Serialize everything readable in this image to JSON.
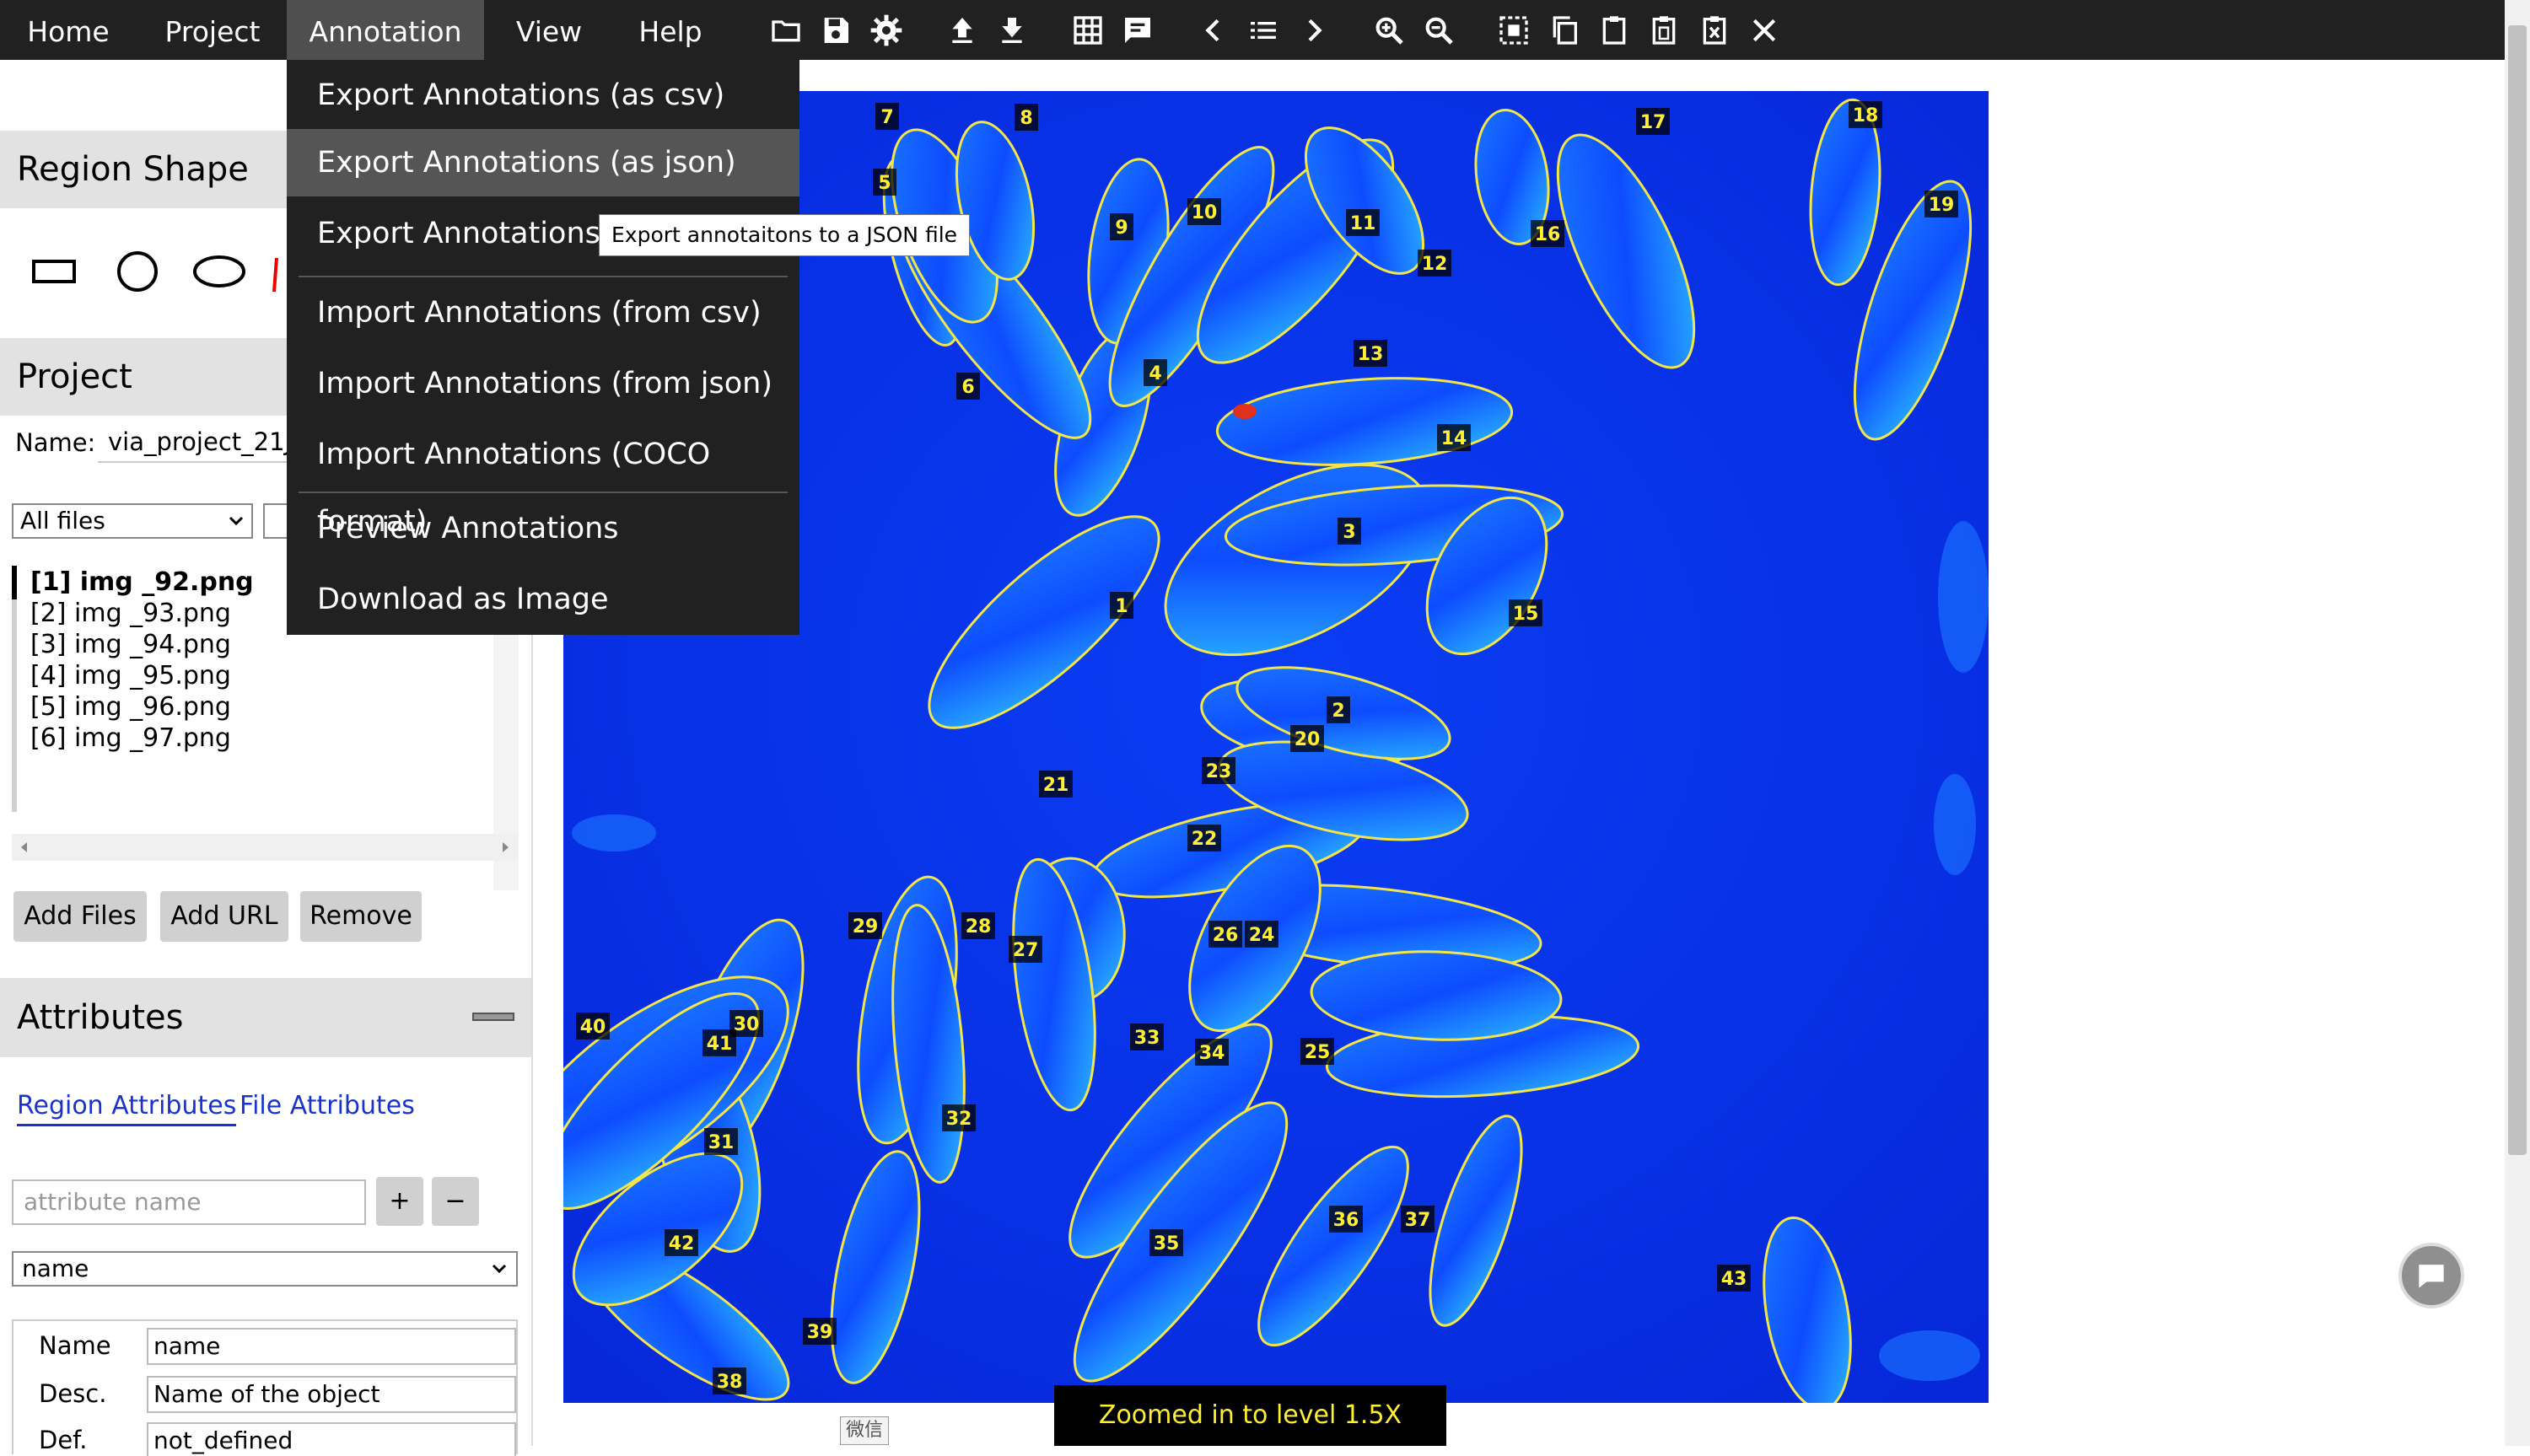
{
  "menubar": {
    "items": [
      "Home",
      "Project",
      "Annotation",
      "View",
      "Help"
    ],
    "active": "Annotation"
  },
  "toolbar_icons": [
    "folder-open-icon",
    "save-icon",
    "settings-icon",
    "upload-icon",
    "download-icon",
    "grid-view-icon",
    "comment-icon",
    "previous-icon",
    "list-icon",
    "next-icon",
    "zoom-in-icon",
    "zoom-out-icon",
    "select-all-icon",
    "copy-icon",
    "paste-icon",
    "paste-special-icon",
    "delete-region-icon",
    "close-icon"
  ],
  "annotation_menu": {
    "items": [
      "Export Annotations (as csv)",
      "Export Annotations (as json)",
      "Export Annotations (COCO format)",
      "Import Annotations (from csv)",
      "Import Annotations (from json)",
      "Import Annotations (COCO format)",
      "Preview Annotations",
      "Download as Image"
    ],
    "visible_item_3": "Export Annotations (C",
    "highlighted": "Export Annotations (as json)",
    "tooltip": "Export annotaitons to a JSON file"
  },
  "region_shape": {
    "title": "Region Shape"
  },
  "project": {
    "title": "Project",
    "name_label": "Name:",
    "name_value": "via_project_21Ju",
    "filter_value": "All files",
    "files": [
      "[1] img _92.png",
      "[2] img _93.png",
      "[3] img _94.png",
      "[4] img _95.png",
      "[5] img _96.png",
      "[6] img _97.png"
    ],
    "selected_file": "[1] img _92.png",
    "buttons": {
      "add_files": "Add Files",
      "add_url": "Add URL",
      "remove": "Remove"
    }
  },
  "attributes": {
    "title": "Attributes",
    "collapse_symbol": "—",
    "tabs": {
      "region": "Region Attributes",
      "file": "File Attributes"
    },
    "attr_name_placeholder": "attribute name",
    "add_symbol": "+",
    "remove_symbol": "−",
    "selected_attribute": "name",
    "rows": [
      {
        "label": "Name",
        "value": "name"
      },
      {
        "label": "Desc.",
        "value": "Name of the object"
      },
      {
        "label": "Def.",
        "value": "not_defined"
      }
    ]
  },
  "viewer": {
    "region_labels": [
      "1",
      "2",
      "3",
      "4",
      "5",
      "6",
      "7",
      "8",
      "9",
      "10",
      "11",
      "12",
      "13",
      "14",
      "15",
      "16",
      "17",
      "18",
      "19",
      "20",
      "21",
      "22",
      "23",
      "24",
      "25",
      "26",
      "27",
      "28",
      "29",
      "30",
      "31",
      "32",
      "33",
      "34",
      "35",
      "36",
      "37",
      "38",
      "39",
      "40",
      "41",
      "42",
      "43"
    ]
  },
  "status_message": "Zoomed in to level 1.5X",
  "wechat_label": "微信",
  "colors": {
    "menubar": "#212121",
    "image_background": "#0a33f0",
    "region_outline": "#f2e64a",
    "label_text": "#ffee33"
  }
}
